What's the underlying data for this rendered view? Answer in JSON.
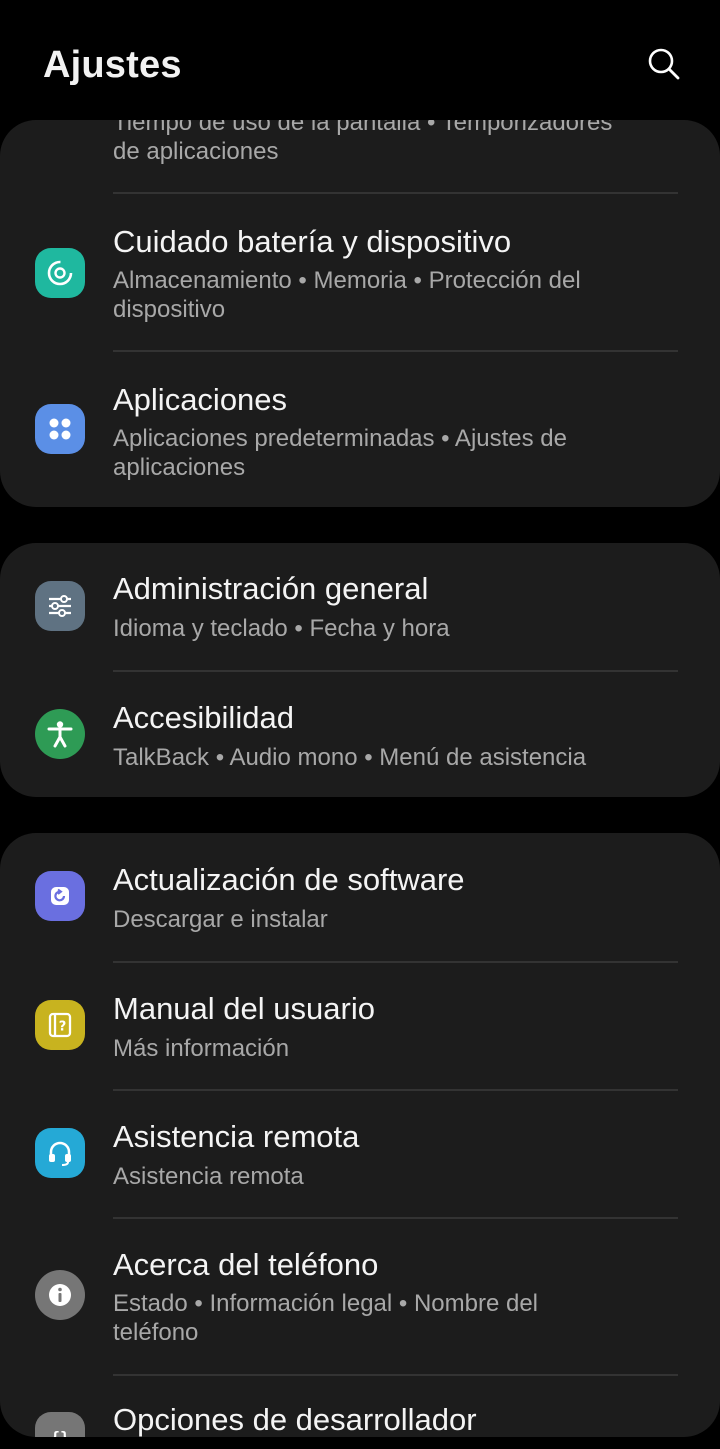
{
  "header": {
    "title": "Ajustes"
  },
  "cards": [
    {
      "items": [
        {
          "partial_subtitle_line1": "Tiempo de uso de la pantalla • Temporizadores",
          "partial_subtitle_line2": "de aplicaciones"
        },
        {
          "title": "Cuidado batería y dispositivo",
          "subtitle_line1": "Almacenamiento • Memoria • Protección del",
          "subtitle_line2": "dispositivo",
          "icon": "battery-care-icon",
          "color": "#1fb89f"
        },
        {
          "title": "Aplicaciones",
          "subtitle_line1": "Aplicaciones predeterminadas • Ajustes de",
          "subtitle_line2": "aplicaciones",
          "icon": "apps-icon",
          "color": "#5b8fe6"
        }
      ]
    },
    {
      "items": [
        {
          "title": "Administración general",
          "subtitle_line1": "Idioma y teclado • Fecha y hora",
          "icon": "sliders-icon",
          "color": "#5f7282"
        },
        {
          "title": "Accesibilidad",
          "subtitle_line1": "TalkBack • Audio mono • Menú de asistencia",
          "icon": "accessibility-icon",
          "color": "#2e9b55"
        }
      ]
    },
    {
      "items": [
        {
          "title": "Actualización de software",
          "subtitle_line1": "Descargar e instalar",
          "icon": "software-update-icon",
          "color": "#6a6fe0"
        },
        {
          "title": "Manual del usuario",
          "subtitle_line1": "Más información",
          "icon": "manual-icon",
          "color": "#c8b31f"
        },
        {
          "title": "Asistencia remota",
          "subtitle_line1": "Asistencia remota",
          "icon": "headset-icon",
          "color": "#25a9d6"
        },
        {
          "title": "Acerca del teléfono",
          "subtitle_line1": "Estado • Información legal • Nombre del",
          "subtitle_line2": "teléfono",
          "icon": "info-icon",
          "color": "#767676"
        },
        {
          "title": "Opciones de desarrollador",
          "icon": "developer-options-icon",
          "color": "#767676"
        }
      ]
    }
  ]
}
